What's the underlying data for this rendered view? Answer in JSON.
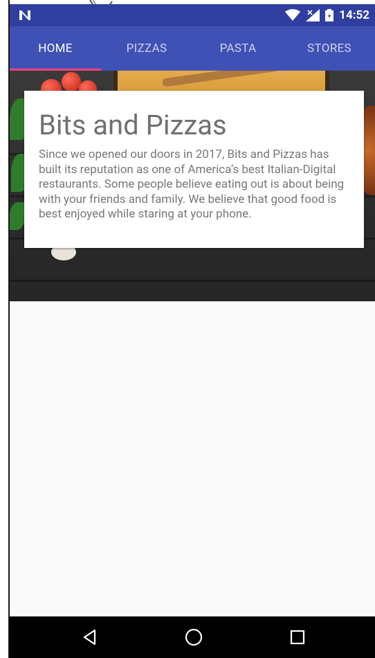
{
  "status_bar": {
    "time": "14:52",
    "notification_icon": "n-logo-icon",
    "icons": [
      "wifi-icon",
      "signal-icon",
      "battery-icon"
    ]
  },
  "tabs": [
    {
      "label": "HOME",
      "active": true
    },
    {
      "label": "PIZZAS",
      "active": false
    },
    {
      "label": "PASTA",
      "active": false
    },
    {
      "label": "STORES",
      "active": false
    }
  ],
  "card": {
    "title": "Bits and Pizzas",
    "body": "Since we opened our doors in 2017, Bits and Pizzas has built its reputation as one of America’s best Italian-Digital restaurants. Some people believe eating out is about being with your friends and family. We believe that good food is best enjoyed while staring at your phone."
  },
  "navigation": {
    "buttons": [
      "back-icon",
      "home-icon",
      "recents-icon"
    ]
  },
  "colors": {
    "primary": "#3f51b5",
    "primary_dark": "#303f9f",
    "accent": "#ff4081"
  }
}
